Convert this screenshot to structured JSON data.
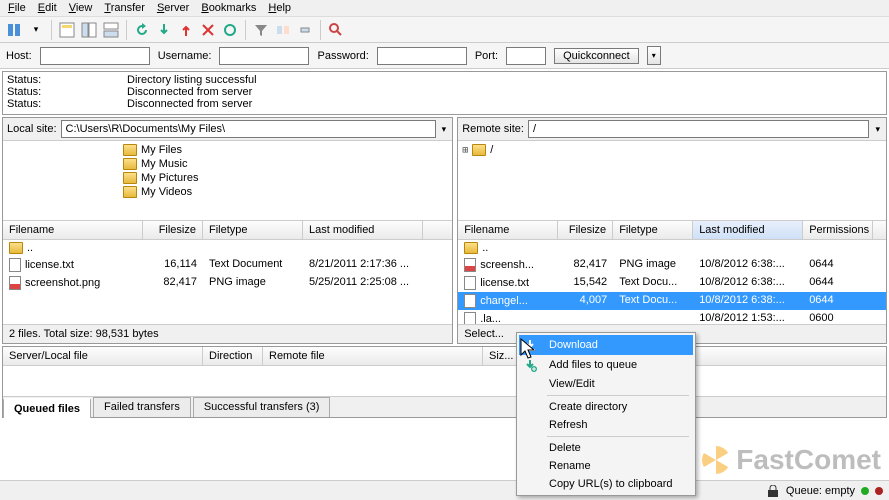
{
  "menu": [
    "File",
    "Edit",
    "View",
    "Transfer",
    "Server",
    "Bookmarks",
    "Help"
  ],
  "quickconnect": {
    "host_label": "Host:",
    "user_label": "Username:",
    "pass_label": "Password:",
    "port_label": "Port:",
    "host": "",
    "user": "",
    "pass": "",
    "port": "",
    "btn": "Quickconnect"
  },
  "status_lines": [
    {
      "label": "Status:",
      "msg": "Directory listing successful"
    },
    {
      "label": "Status:",
      "msg": "Disconnected from server"
    },
    {
      "label": "Status:",
      "msg": "Disconnected from server"
    }
  ],
  "local": {
    "label": "Local site:",
    "path": "C:\\Users\\R\\Documents\\My Files\\",
    "tree": [
      "My Files",
      "My Music",
      "My Pictures",
      "My Videos"
    ],
    "cols": [
      "Filename",
      "Filesize",
      "Filetype",
      "Last modified"
    ],
    "rows": [
      {
        "name": "..",
        "size": "",
        "type": "",
        "mod": "",
        "icon": "folder"
      },
      {
        "name": "license.txt",
        "size": "16,114",
        "type": "Text Document",
        "mod": "8/21/2011 2:17:36 ...",
        "icon": "file"
      },
      {
        "name": "screenshot.png",
        "size": "82,417",
        "type": "PNG image",
        "mod": "5/25/2011 2:25:08 ...",
        "icon": "png"
      }
    ],
    "summary": "2 files. Total size: 98,531 bytes"
  },
  "remote": {
    "label": "Remote site:",
    "path": "/",
    "tree_root": "/",
    "cols": [
      "Filename",
      "Filesize",
      "Filetype",
      "Last modified",
      "Permissions"
    ],
    "rows": [
      {
        "name": "..",
        "size": "",
        "type": "",
        "mod": "",
        "perm": "",
        "icon": "folder"
      },
      {
        "name": "screensh...",
        "size": "82,417",
        "type": "PNG image",
        "mod": "10/8/2012 6:38:...",
        "perm": "0644",
        "icon": "png"
      },
      {
        "name": "license.txt",
        "size": "15,542",
        "type": "Text Docu...",
        "mod": "10/8/2012 6:38:...",
        "perm": "0644",
        "icon": "file"
      },
      {
        "name": "changel...",
        "size": "4,007",
        "type": "Text Docu...",
        "mod": "10/8/2012 6:38:...",
        "perm": "0644",
        "icon": "file",
        "sel": true
      },
      {
        "name": ".la...",
        "size": "",
        "type": "",
        "mod": "10/8/2012 1:53:...",
        "perm": "0600",
        "icon": "file"
      }
    ],
    "summary": "Select..."
  },
  "queue": {
    "cols": [
      "Server/Local file",
      "Direction",
      "Remote file",
      "Siz..."
    ],
    "tabs": [
      "Queued files",
      "Failed transfers",
      "Successful transfers (3)"
    ]
  },
  "statusbar": {
    "queue": "Queue: empty"
  },
  "context": {
    "items": [
      {
        "label": "Download",
        "icon": "download",
        "sel": true
      },
      {
        "label": "Add files to queue",
        "icon": "add"
      },
      {
        "label": "View/Edit"
      },
      {
        "sep": true
      },
      {
        "label": "Create directory"
      },
      {
        "label": "Refresh"
      },
      {
        "sep": true
      },
      {
        "label": "Delete"
      },
      {
        "label": "Rename"
      },
      {
        "label": "Copy URL(s) to clipboard"
      }
    ]
  },
  "watermark": "FastComet"
}
